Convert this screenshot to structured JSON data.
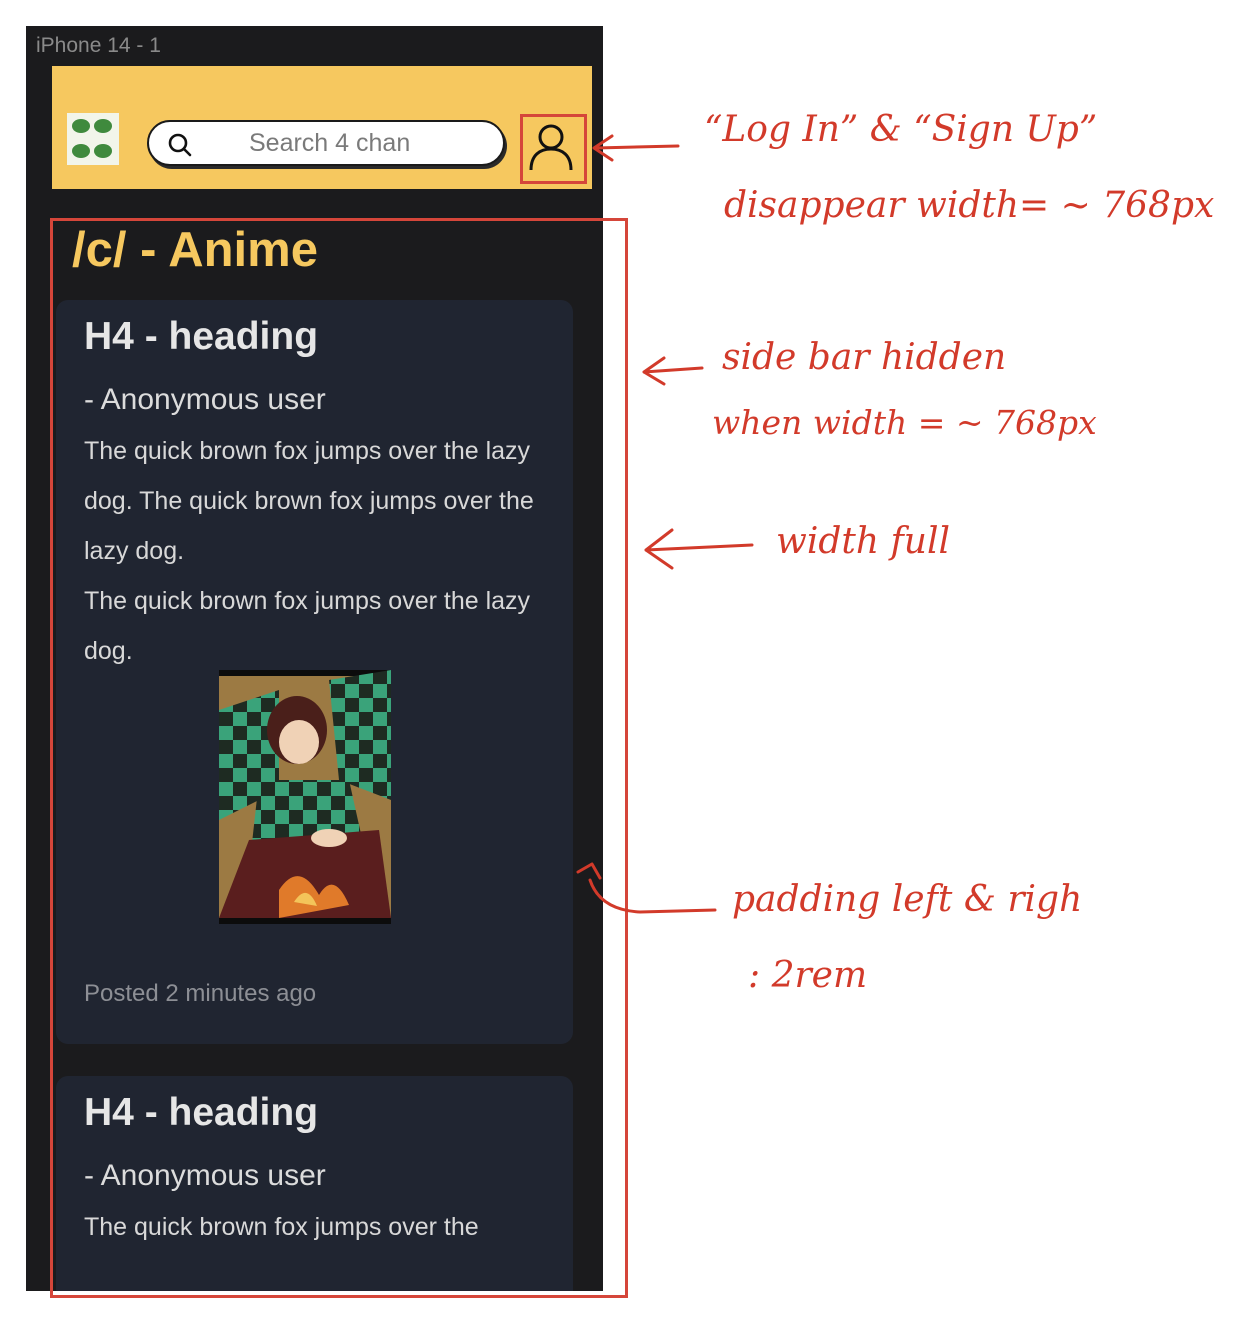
{
  "frame": {
    "label": "iPhone 14 - 1"
  },
  "header": {
    "logo_icon": "four-leaf-clover-icon",
    "search": {
      "placeholder": "Search 4 chan",
      "value": "",
      "icon": "search-icon"
    },
    "user_icon": "user-icon"
  },
  "board": {
    "title": "/c/ - Anime"
  },
  "posts": [
    {
      "heading": "H4 - heading",
      "author": "- Anonymous user",
      "body": [
        "The quick brown fox jumps over the lazy dog. The quick brown fox jumps over the lazy dog.",
        "The quick brown fox jumps over the lazy dog."
      ],
      "image": "anime-character-image",
      "posted": "Posted 2 minutes ago"
    },
    {
      "heading": "H4 - heading",
      "author": "- Anonymous user",
      "body": [
        "The quick brown fox jumps over the"
      ]
    }
  ],
  "annotations": {
    "header_note_line1": "“Log In” & “Sign Up”",
    "header_note_line2": "disappear width= ~ 768px",
    "sidebar_note_line1": "side bar hidden",
    "sidebar_note_line2": "when width = ~ 768px",
    "width_note": "width full",
    "padding_note_line1": "padding left & righ",
    "padding_note_line2": ": 2rem"
  },
  "colors": {
    "accent": "#f6c85f",
    "annotation": "#d23a2a",
    "card": "#202531",
    "background": "#1b1b1d"
  }
}
